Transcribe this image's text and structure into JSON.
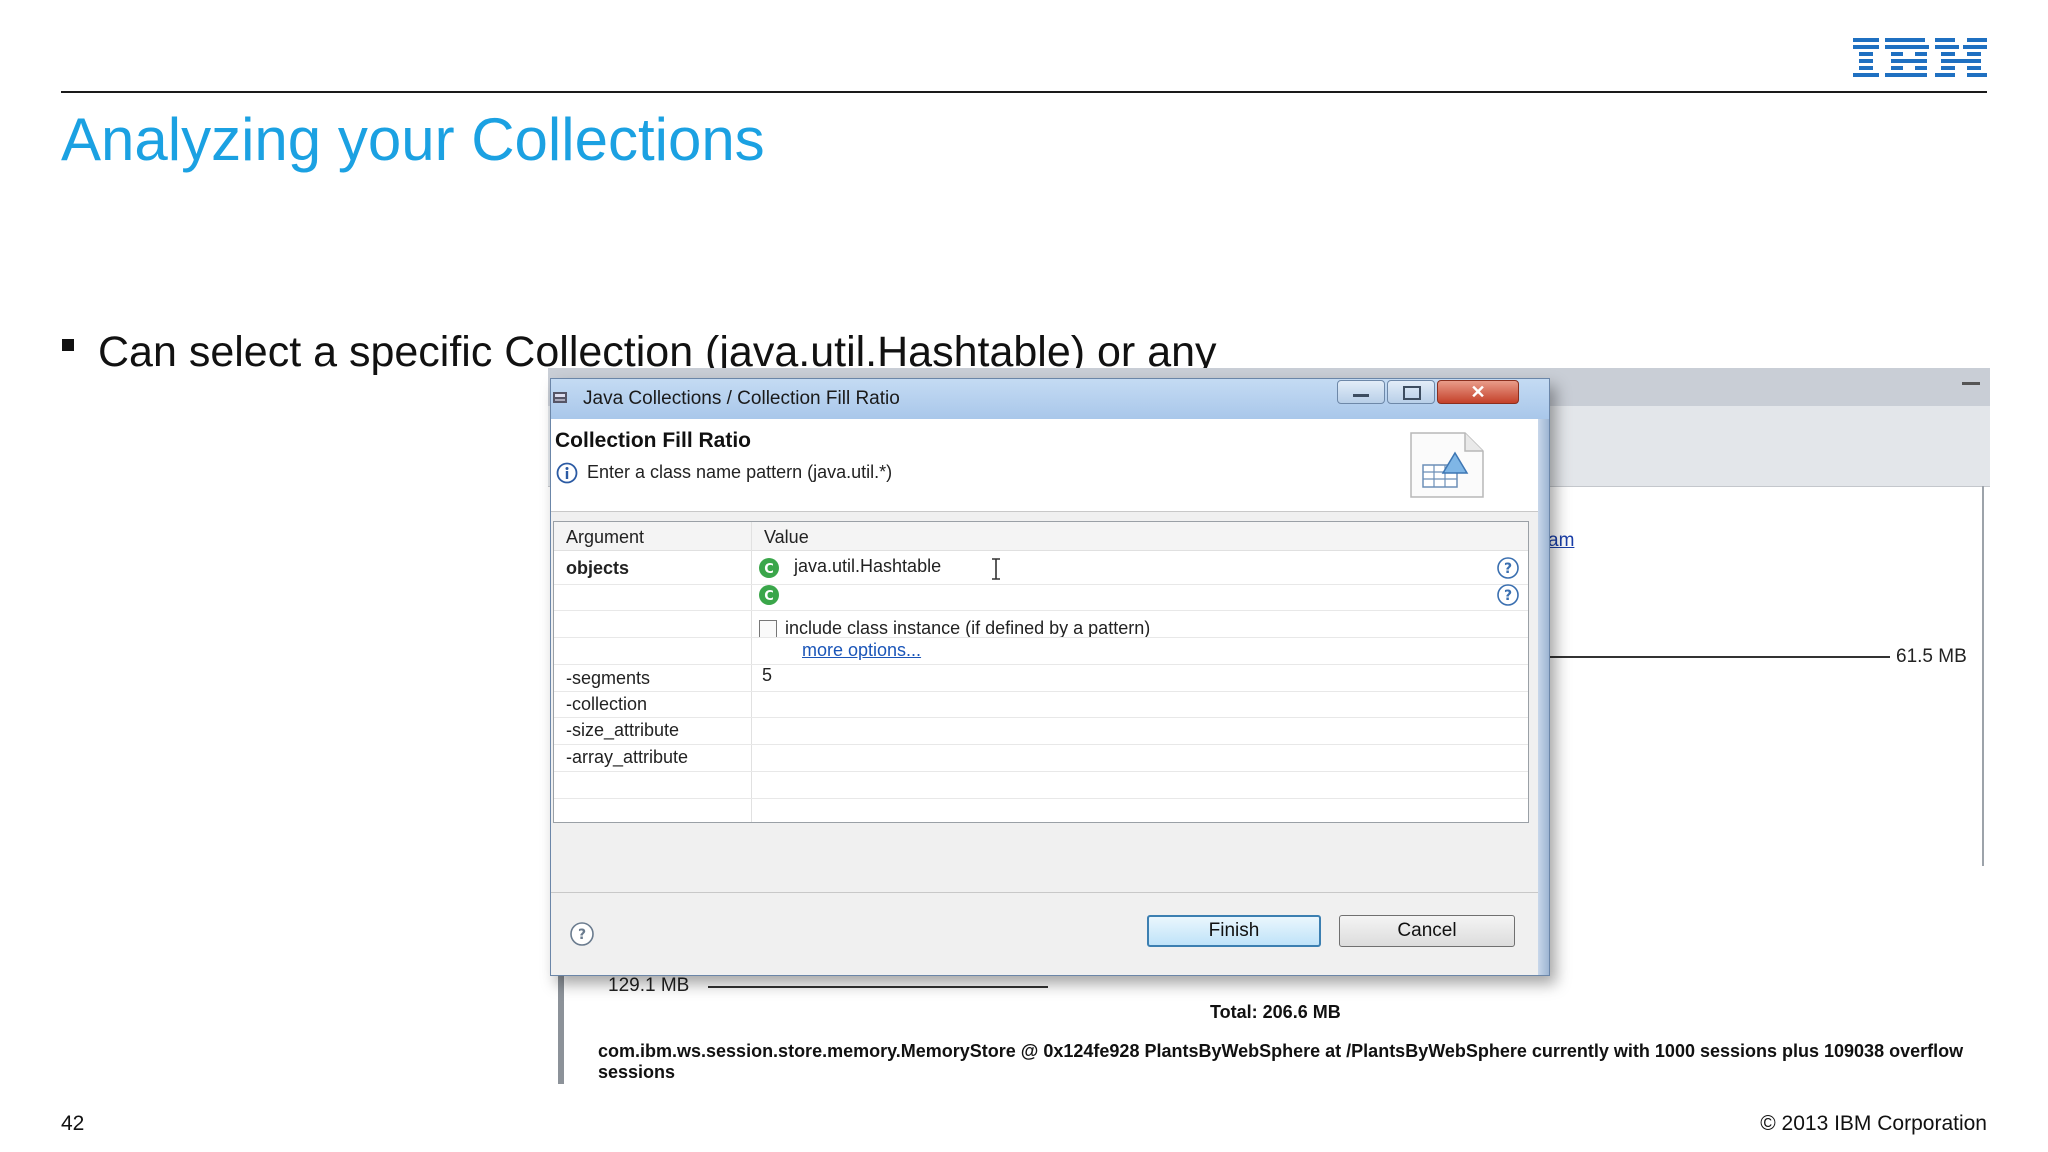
{
  "slide": {
    "title": "Analyzing your Collections",
    "bullet": "Can select a specific Collection (java.util.Hashtable) or any",
    "page_number": "42",
    "copyright": "© 2013 IBM Corporation",
    "logo": "IBM",
    "title_color": "#1ba1e2"
  },
  "background_screenshot": {
    "link_fragment": "am",
    "graph_value": "61.5 MB",
    "small_value": "129.1 MB",
    "total": "Total: 206.6 MB",
    "description": "com.ibm.ws.session.store.memory.MemoryStore @ 0x124fe928 PlantsByWebSphere at /PlantsByWebSphere currently with 1000 sessions plus 109038 overflow sessions"
  },
  "dialog": {
    "window_title": "Java Collections / Collection Fill Ratio",
    "close_glyph": "✕",
    "header_title": "Collection Fill Ratio",
    "header_message": "Enter a class name pattern (java.util.*)",
    "table": {
      "col_argument": "Argument",
      "col_value": "Value",
      "objects_label": "objects",
      "objects_value": "java.util.Hashtable",
      "include_label": "include class instance (if defined by a pattern)",
      "more_options": "more options...",
      "args": [
        {
          "name": "-segments",
          "value": "5"
        },
        {
          "name": "-collection",
          "value": ""
        },
        {
          "name": "-size_attribute",
          "value": ""
        },
        {
          "name": "-array_attribute",
          "value": ""
        }
      ]
    },
    "finish": "Finish",
    "cancel": "Cancel"
  }
}
